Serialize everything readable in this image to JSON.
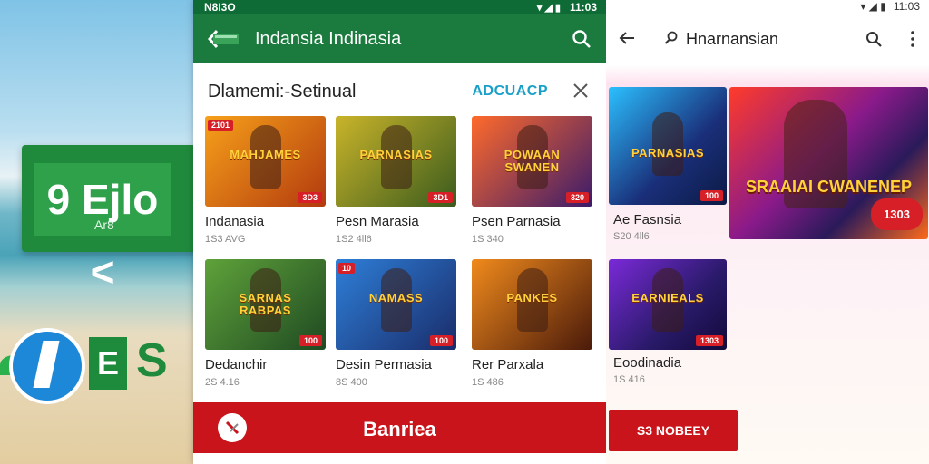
{
  "left_bg": {
    "sign_text": "9 Ejlo <",
    "sign_sub": "Ar8",
    "logo_e": "E",
    "logo_s": "S"
  },
  "status": {
    "left": "N8I3O",
    "right": "11:03"
  },
  "appbar": {
    "title": "Indansia Indinasia",
    "back_icon": "back-arrow-icon",
    "search_icon": "search-icon"
  },
  "sheet": {
    "title": "Dlamemi:-Setinual",
    "action": "ADCUACP",
    "close_icon": "close-icon"
  },
  "cards": [
    {
      "name": "Indanasia",
      "sub": "1S3 AVG",
      "logo": "MAHJAMES",
      "corner": "2101",
      "badge": "3D3",
      "colors": [
        "#f7a11a",
        "#b23a0e"
      ]
    },
    {
      "name": "Pesn Marasia",
      "sub": "1S2 4ll6",
      "logo": "PARNASIAS",
      "corner": "",
      "badge": "3D1",
      "colors": [
        "#c9b42a",
        "#3b5b1d"
      ]
    },
    {
      "name": "Psen Parnasia",
      "sub": "1S 340",
      "logo": "POWAAN SWANEN",
      "corner": "",
      "badge": "320",
      "colors": [
        "#ff6a2b",
        "#3a1b6b"
      ]
    },
    {
      "name": "Dedanchir",
      "sub": "2S 4.16",
      "logo": "SARNAS RABPAS",
      "corner": "",
      "badge": "100",
      "colors": [
        "#5fa23a",
        "#1f4a22"
      ]
    },
    {
      "name": "Desin Permasia",
      "sub": "8S 400",
      "logo": "NAMASS",
      "corner": "10",
      "badge": "100",
      "colors": [
        "#2e7fd8",
        "#1a2c6a"
      ]
    },
    {
      "name": "Rer Parxala",
      "sub": "1S 486",
      "logo": "PANKES",
      "corner": "",
      "badge": "",
      "colors": [
        "#f08a1c",
        "#4a1a0a"
      ]
    }
  ],
  "bottombar": {
    "label": "Banriea",
    "fab_icon": "no-sound-icon"
  },
  "right": {
    "status": "11:03",
    "search_text": "Hnarnansian",
    "back_icon": "back-arrow-icon",
    "search_icon": "search-icon",
    "menu_icon": "more-vert-icon",
    "card1": {
      "name": "Ae Fasnsia",
      "sub": "S20 4ll6",
      "logo": "PARNASIAS",
      "badge": "100"
    },
    "card2": {
      "logo": "SRAAIAI CWANENEP",
      "badge": "1303"
    },
    "card3": {
      "name": "Eoodinadia",
      "sub": "1S 416",
      "logo": "EARNIEALS",
      "badge": "1303"
    },
    "button": "S3 NOBEEY"
  }
}
